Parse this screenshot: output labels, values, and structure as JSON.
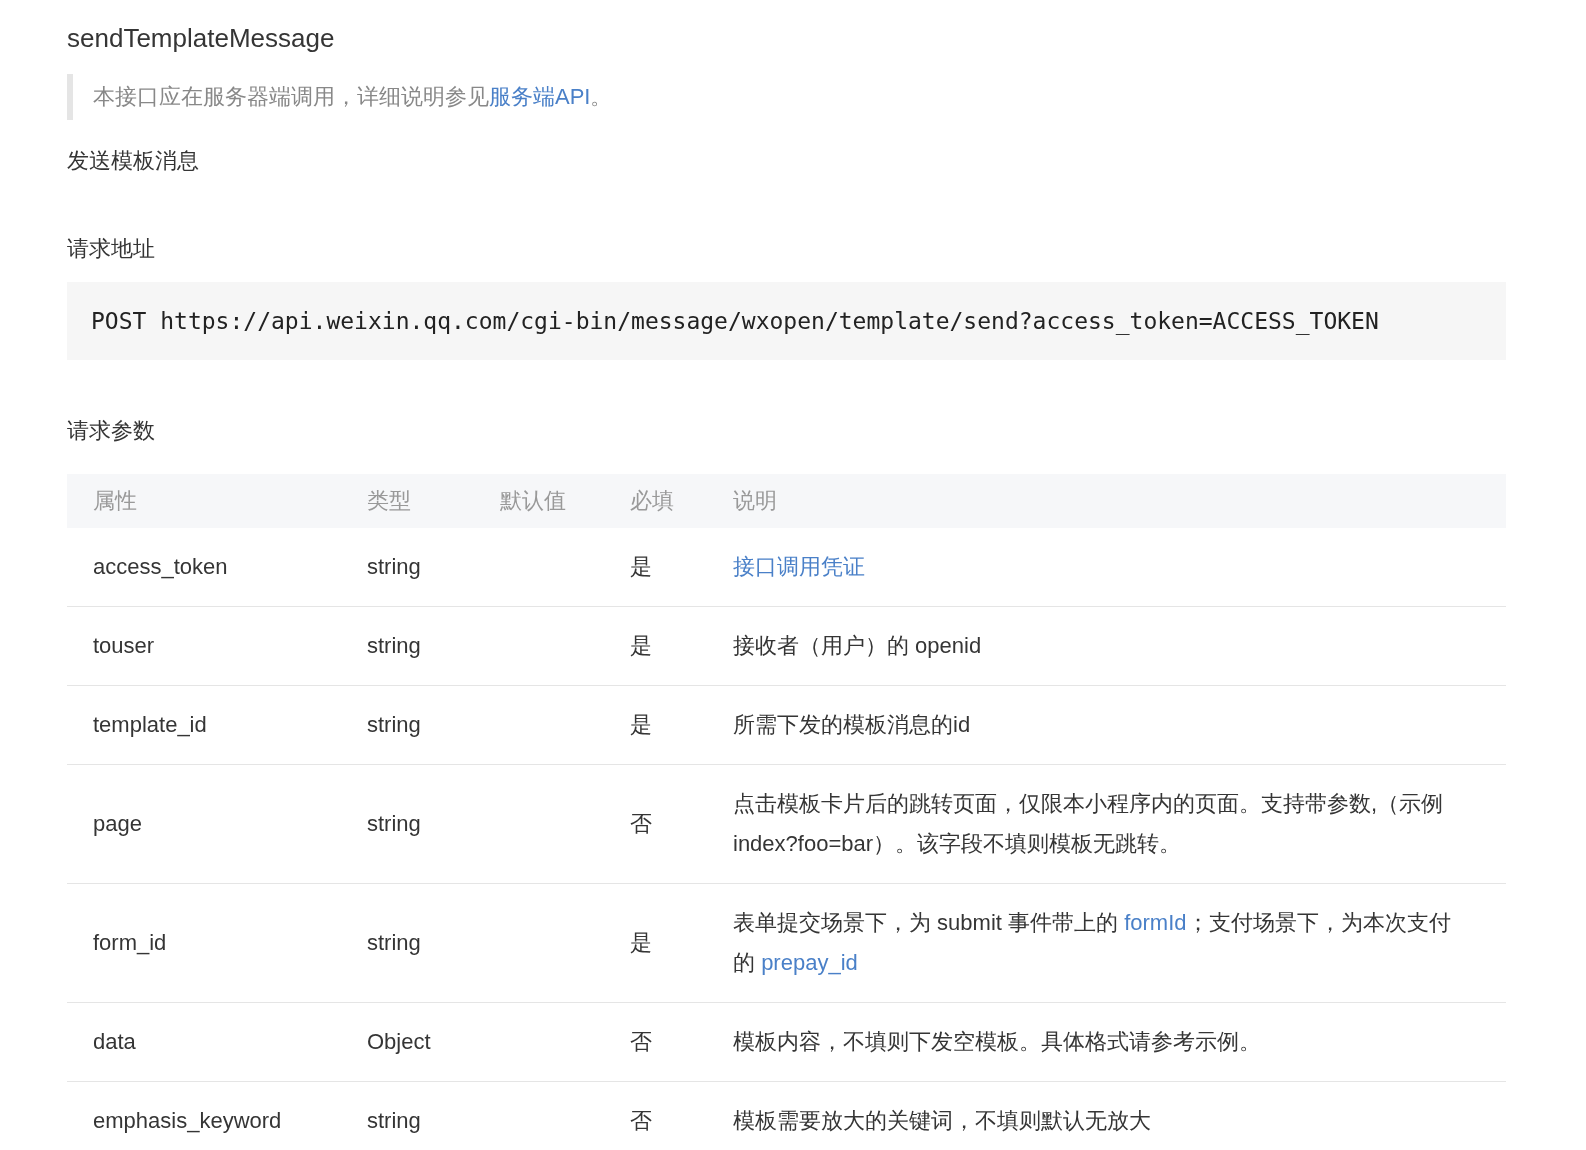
{
  "title": "sendTemplateMessage",
  "note": {
    "parts": [
      {
        "kind": "text",
        "text": "本接口应在服务器端调用，详细说明参见"
      },
      {
        "kind": "link",
        "text": "服务端API"
      },
      {
        "kind": "text",
        "text": "。"
      }
    ]
  },
  "description": "发送模板消息",
  "request_url": {
    "heading": "请求地址",
    "code": "POST https://api.weixin.qq.com/cgi-bin/message/wxopen/template/send?access_token=ACCESS_TOKEN"
  },
  "params": {
    "heading": "请求参数",
    "table": {
      "columns": [
        "属性",
        "类型",
        "默认值",
        "必填",
        "说明"
      ],
      "rows": [
        {
          "name": "access_token",
          "type": "string",
          "required": "是",
          "description": [
            {
              "kind": "link",
              "text": "接口调用凭证"
            }
          ]
        },
        {
          "name": "touser",
          "type": "string",
          "required": "是",
          "description": [
            {
              "kind": "text",
              "text": "接收者（用户）的 openid"
            }
          ]
        },
        {
          "name": "template_id",
          "type": "string",
          "required": "是",
          "description": [
            {
              "kind": "text",
              "text": "所需下发的模板消息的id"
            }
          ]
        },
        {
          "name": "page",
          "type": "string",
          "required": "否",
          "description": [
            {
              "kind": "text",
              "text": "点击模板卡片后的跳转页面，仅限本小程序内的页面。支持带参数,（示例index?foo=bar）。该字段不填则模板无跳转。"
            }
          ]
        },
        {
          "name": "form_id",
          "type": "string",
          "required": "是",
          "description": [
            {
              "kind": "text",
              "text": "表单提交场景下，为 submit 事件带上的 "
            },
            {
              "kind": "link",
              "text": "formId"
            },
            {
              "kind": "text",
              "text": "；支付场景下，为本次支付的 "
            },
            {
              "kind": "link",
              "text": "prepay_id"
            }
          ]
        },
        {
          "name": "data",
          "type": "Object",
          "required": "否",
          "description": [
            {
              "kind": "text",
              "text": "模板内容，不填则下发空模板。具体格式请参考示例。"
            }
          ]
        },
        {
          "name": "emphasis_keyword",
          "type": "string",
          "required": "否",
          "description": [
            {
              "kind": "text",
              "text": "模板需要放大的关键词，不填则默认无放大"
            }
          ]
        }
      ]
    }
  }
}
